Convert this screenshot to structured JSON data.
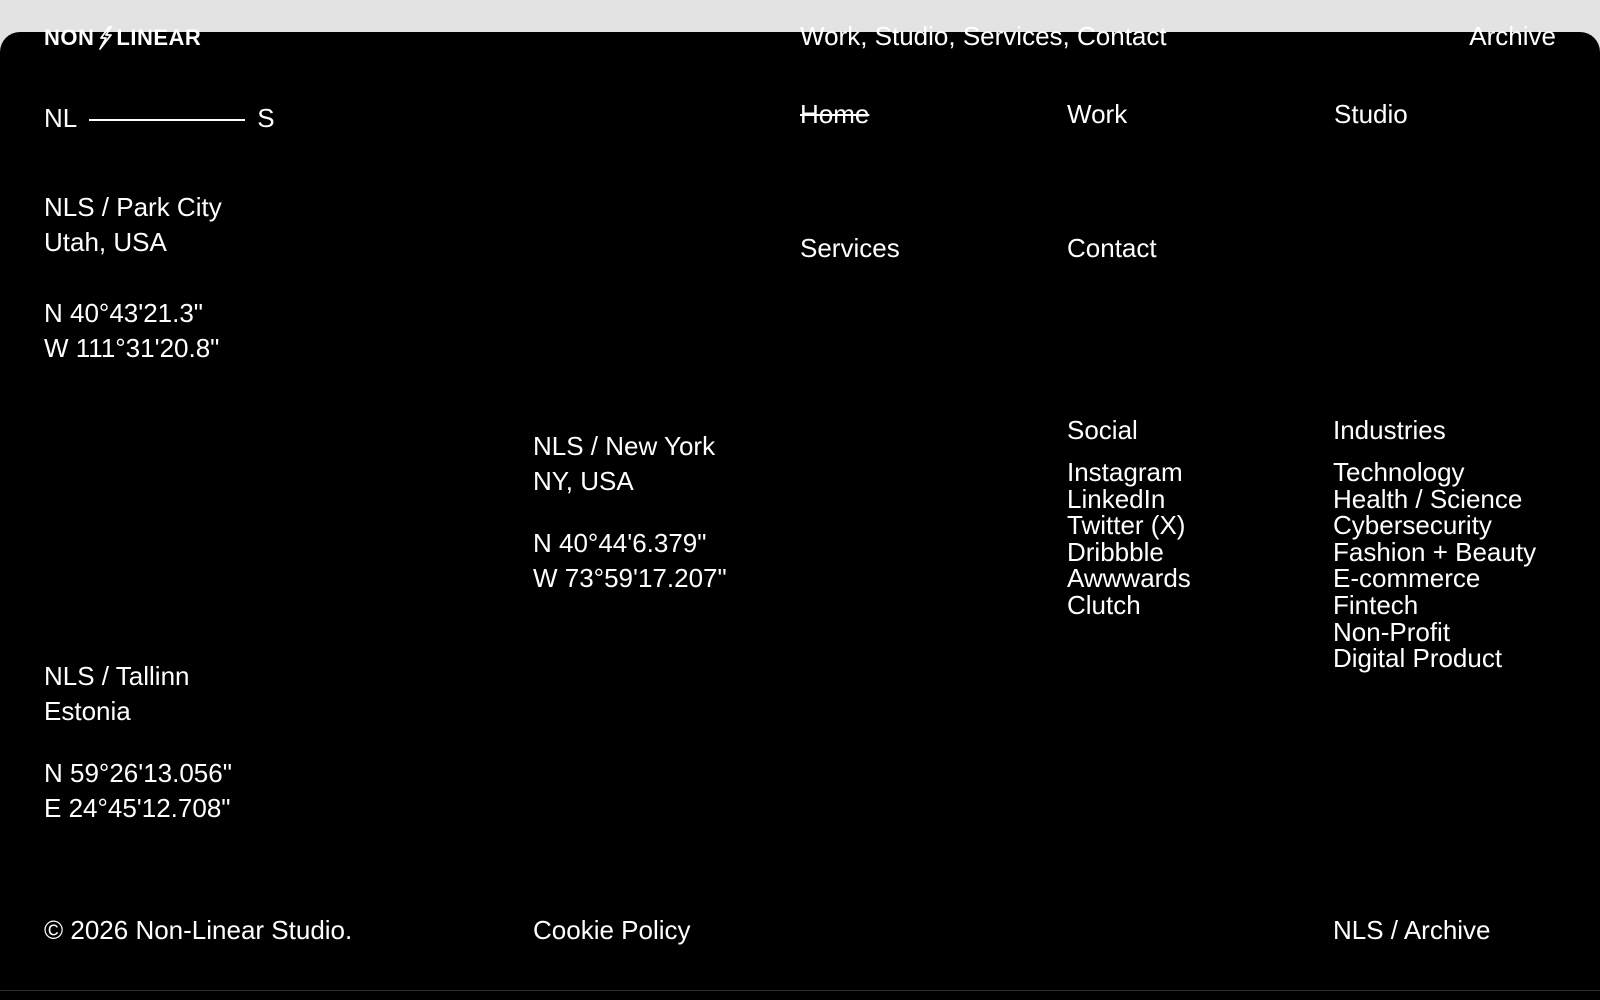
{
  "header": {
    "logo_left": "NON",
    "logo_right": "LINEAR",
    "nav": [
      {
        "label": "Work"
      },
      {
        "label": "Studio"
      },
      {
        "label": "Services"
      },
      {
        "label": "Contact"
      }
    ],
    "archive": "Archive"
  },
  "mark": {
    "left": "NL",
    "right": "S"
  },
  "menu": {
    "home": "Home",
    "work": "Work",
    "studio": "Studio",
    "services": "Services",
    "contact": "Contact"
  },
  "locations": [
    {
      "name": "NLS / Park City",
      "region": "Utah, USA",
      "lat": "N 40°43'21.3\"",
      "lon": "W 111°31'20.8\""
    },
    {
      "name": "NLS / New York",
      "region": "NY, USA",
      "lat": "N 40°44'6.379\"",
      "lon": "W 73°59'17.207\""
    },
    {
      "name": "NLS / Tallinn",
      "region": "Estonia",
      "lat": "N 59°26'13.056\"",
      "lon": "E 24°45'12.708\""
    }
  ],
  "social": {
    "title": "Social",
    "items": [
      "Instagram",
      "LinkedIn",
      "Twitter (X)",
      "Dribbble",
      "Awwwards",
      "Clutch"
    ]
  },
  "industries": {
    "title": "Industries",
    "items": [
      "Technology",
      "Health / Science",
      "Cybersecurity",
      "Fashion + Beauty",
      "E-commerce",
      "Fintech",
      "Non-Profit",
      "Digital Product"
    ]
  },
  "footer": {
    "copyright": "© 2026 Non-Linear Studio.",
    "cookie": "Cookie Policy",
    "archive": "NLS / Archive"
  },
  "colors": {
    "background": "#000000",
    "text": "#ffffff",
    "page_edge": "#e3e3e3"
  }
}
